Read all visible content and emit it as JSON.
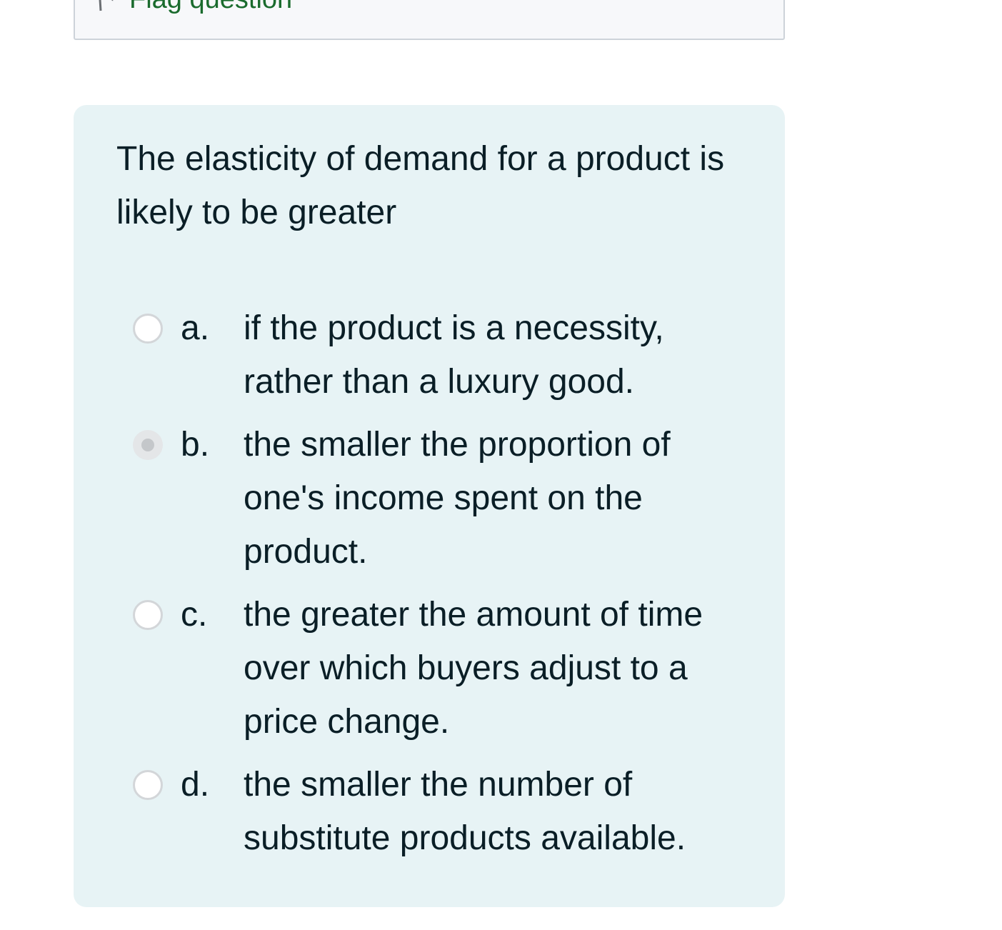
{
  "flag": {
    "label": "Flag question",
    "icon": "flag-icon"
  },
  "question": {
    "text": "The elasticity of demand for a product is likely to be greater",
    "options": [
      {
        "letter": "a.",
        "text": "if the product is a necessity, rather than a luxury good.",
        "selected": false
      },
      {
        "letter": "b.",
        "text": "the smaller the proportion of one's income spent on the product.",
        "selected": true
      },
      {
        "letter": "c.",
        "text": "the greater the amount of time over which buyers adjust to a price change.",
        "selected": false
      },
      {
        "letter": "d.",
        "text": "the smaller the number of substitute products available.",
        "selected": false
      }
    ]
  },
  "colors": {
    "card_background": "#e7f3f5",
    "link": "#1a6b2d",
    "text": "#0a1e26"
  }
}
